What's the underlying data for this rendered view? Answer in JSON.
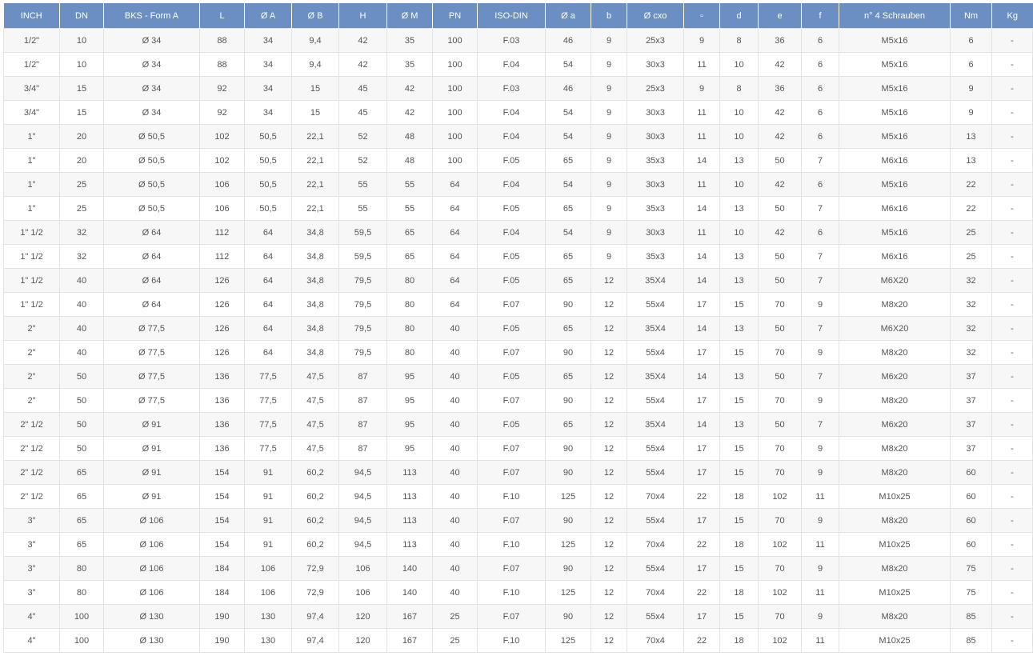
{
  "table": {
    "headers": [
      "INCH",
      "DN",
      "BKS - Form A",
      "L",
      "Ø A",
      "Ø B",
      "H",
      "Ø M",
      "PN",
      "ISO-DIN",
      "Ø a",
      "b",
      "Ø cxo",
      "▫",
      "d",
      "e",
      "f",
      "n° 4 Schrauben",
      "Nm",
      "Kg"
    ],
    "rows": [
      [
        "1/2\"",
        "10",
        "Ø 34",
        "88",
        "34",
        "9,4",
        "42",
        "35",
        "100",
        "F.03",
        "46",
        "9",
        "25x3",
        "9",
        "8",
        "36",
        "6",
        "M5x16",
        "6",
        "-"
      ],
      [
        "1/2\"",
        "10",
        "Ø 34",
        "88",
        "34",
        "9,4",
        "42",
        "35",
        "100",
        "F.04",
        "54",
        "9",
        "30x3",
        "11",
        "10",
        "42",
        "6",
        "M5x16",
        "6",
        "-"
      ],
      [
        "3/4\"",
        "15",
        "Ø 34",
        "92",
        "34",
        "15",
        "45",
        "42",
        "100",
        "F.03",
        "46",
        "9",
        "25x3",
        "9",
        "8",
        "36",
        "6",
        "M5x16",
        "9",
        "-"
      ],
      [
        "3/4\"",
        "15",
        "Ø 34",
        "92",
        "34",
        "15",
        "45",
        "42",
        "100",
        "F.04",
        "54",
        "9",
        "30x3",
        "11",
        "10",
        "42",
        "6",
        "M5x16",
        "9",
        "-"
      ],
      [
        "1\"",
        "20",
        "Ø 50,5",
        "102",
        "50,5",
        "22,1",
        "52",
        "48",
        "100",
        "F.04",
        "54",
        "9",
        "30x3",
        "11",
        "10",
        "42",
        "6",
        "M5x16",
        "13",
        "-"
      ],
      [
        "1\"",
        "20",
        "Ø 50,5",
        "102",
        "50,5",
        "22,1",
        "52",
        "48",
        "100",
        "F.05",
        "65",
        "9",
        "35x3",
        "14",
        "13",
        "50",
        "7",
        "M6x16",
        "13",
        "-"
      ],
      [
        "1\"",
        "25",
        "Ø 50,5",
        "106",
        "50,5",
        "22,1",
        "55",
        "55",
        "64",
        "F.04",
        "54",
        "9",
        "30x3",
        "11",
        "10",
        "42",
        "6",
        "M5x16",
        "22",
        "-"
      ],
      [
        "1\"",
        "25",
        "Ø 50,5",
        "106",
        "50,5",
        "22,1",
        "55",
        "55",
        "64",
        "F.05",
        "65",
        "9",
        "35x3",
        "14",
        "13",
        "50",
        "7",
        "M6x16",
        "22",
        "-"
      ],
      [
        "1\" 1/2",
        "32",
        "Ø 64",
        "112",
        "64",
        "34,8",
        "59,5",
        "65",
        "64",
        "F.04",
        "54",
        "9",
        "30x3",
        "11",
        "10",
        "42",
        "6",
        "M5x16",
        "25",
        "-"
      ],
      [
        "1\" 1/2",
        "32",
        "Ø 64",
        "112",
        "64",
        "34,8",
        "59,5",
        "65",
        "64",
        "F.05",
        "65",
        "9",
        "35x3",
        "14",
        "13",
        "50",
        "7",
        "M6x16",
        "25",
        "-"
      ],
      [
        "1\" 1/2",
        "40",
        "Ø 64",
        "126",
        "64",
        "34,8",
        "79,5",
        "80",
        "64",
        "F.05",
        "65",
        "12",
        "35X4",
        "14",
        "13",
        "50",
        "7",
        "M6X20",
        "32",
        "-"
      ],
      [
        "1\" 1/2",
        "40",
        "Ø 64",
        "126",
        "64",
        "34,8",
        "79,5",
        "80",
        "64",
        "F.07",
        "90",
        "12",
        "55x4",
        "17",
        "15",
        "70",
        "9",
        "M8x20",
        "32",
        "-"
      ],
      [
        "2\"",
        "40",
        "Ø 77,5",
        "126",
        "64",
        "34,8",
        "79,5",
        "80",
        "40",
        "F.05",
        "65",
        "12",
        "35X4",
        "14",
        "13",
        "50",
        "7",
        "M6X20",
        "32",
        "-"
      ],
      [
        "2\"",
        "40",
        "Ø 77,5",
        "126",
        "64",
        "34,8",
        "79,5",
        "80",
        "40",
        "F.07",
        "90",
        "12",
        "55x4",
        "17",
        "15",
        "70",
        "9",
        "M8x20",
        "32",
        "-"
      ],
      [
        "2\"",
        "50",
        "Ø 77,5",
        "136",
        "77,5",
        "47,5",
        "87",
        "95",
        "40",
        "F.05",
        "65",
        "12",
        "35X4",
        "14",
        "13",
        "50",
        "7",
        "M6x20",
        "37",
        "-"
      ],
      [
        "2\"",
        "50",
        "Ø 77,5",
        "136",
        "77,5",
        "47,5",
        "87",
        "95",
        "40",
        "F.07",
        "90",
        "12",
        "55x4",
        "17",
        "15",
        "70",
        "9",
        "M8x20",
        "37",
        "-"
      ],
      [
        "2\" 1/2",
        "50",
        "Ø 91",
        "136",
        "77,5",
        "47,5",
        "87",
        "95",
        "40",
        "F.05",
        "65",
        "12",
        "35X4",
        "14",
        "13",
        "50",
        "7",
        "M6x20",
        "37",
        "-"
      ],
      [
        "2\" 1/2",
        "50",
        "Ø 91",
        "136",
        "77,5",
        "47,5",
        "87",
        "95",
        "40",
        "F.07",
        "90",
        "12",
        "55x4",
        "17",
        "15",
        "70",
        "9",
        "M8x20",
        "37",
        "-"
      ],
      [
        "2\" 1/2",
        "65",
        "Ø 91",
        "154",
        "91",
        "60,2",
        "94,5",
        "113",
        "40",
        "F.07",
        "90",
        "12",
        "55x4",
        "17",
        "15",
        "70",
        "9",
        "M8x20",
        "60",
        "-"
      ],
      [
        "2\" 1/2",
        "65",
        "Ø 91",
        "154",
        "91",
        "60,2",
        "94,5",
        "113",
        "40",
        "F.10",
        "125",
        "12",
        "70x4",
        "22",
        "18",
        "102",
        "11",
        "M10x25",
        "60",
        "-"
      ],
      [
        "3\"",
        "65",
        "Ø 106",
        "154",
        "91",
        "60,2",
        "94,5",
        "113",
        "40",
        "F.07",
        "90",
        "12",
        "55x4",
        "17",
        "15",
        "70",
        "9",
        "M8x20",
        "60",
        "-"
      ],
      [
        "3\"",
        "65",
        "Ø 106",
        "154",
        "91",
        "60,2",
        "94,5",
        "113",
        "40",
        "F.10",
        "125",
        "12",
        "70x4",
        "22",
        "18",
        "102",
        "11",
        "M10x25",
        "60",
        "-"
      ],
      [
        "3\"",
        "80",
        "Ø 106",
        "184",
        "106",
        "72,9",
        "106",
        "140",
        "40",
        "F.07",
        "90",
        "12",
        "55x4",
        "17",
        "15",
        "70",
        "9",
        "M8x20",
        "75",
        "-"
      ],
      [
        "3\"",
        "80",
        "Ø 106",
        "184",
        "106",
        "72,9",
        "106",
        "140",
        "40",
        "F.10",
        "125",
        "12",
        "70x4",
        "22",
        "18",
        "102",
        "11",
        "M10x25",
        "75",
        "-"
      ],
      [
        "4\"",
        "100",
        "Ø 130",
        "190",
        "130",
        "97,4",
        "120",
        "167",
        "25",
        "F.07",
        "90",
        "12",
        "55x4",
        "17",
        "15",
        "70",
        "9",
        "M8x20",
        "85",
        "-"
      ],
      [
        "4\"",
        "100",
        "Ø 130",
        "190",
        "130",
        "97,4",
        "120",
        "167",
        "25",
        "F.10",
        "125",
        "12",
        "70x4",
        "22",
        "18",
        "102",
        "11",
        "M10x25",
        "85",
        "-"
      ]
    ]
  }
}
